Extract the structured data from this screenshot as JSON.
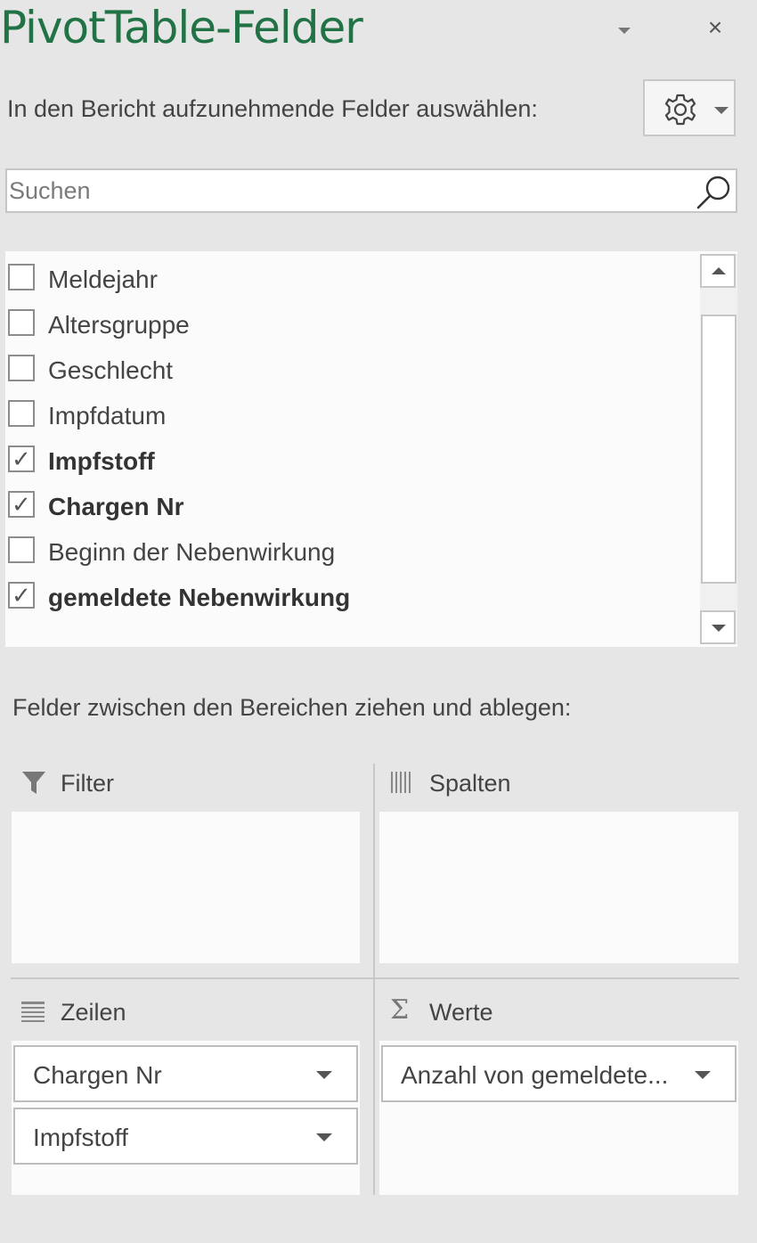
{
  "header": {
    "title": "PivotTable-Felder",
    "close_glyph": "×"
  },
  "chooser": {
    "label": "In den Bericht aufzunehmende Felder auswählen:",
    "settings_icon": "gear-icon"
  },
  "search": {
    "placeholder": "Suchen",
    "value": ""
  },
  "fields": [
    {
      "label": "Meldejahr",
      "checked": false
    },
    {
      "label": "Altersgruppe",
      "checked": false
    },
    {
      "label": "Geschlecht",
      "checked": false
    },
    {
      "label": "Impfdatum",
      "checked": false
    },
    {
      "label": "Impfstoff",
      "checked": true
    },
    {
      "label": "Chargen Nr",
      "checked": true
    },
    {
      "label": "Beginn der Nebenwirkung",
      "checked": false
    },
    {
      "label": "gemeldete Nebenwirkung",
      "checked": true
    }
  ],
  "areas": {
    "instruction": "Felder zwischen den Bereichen ziehen und ablegen:",
    "filter": {
      "label": "Filter",
      "items": []
    },
    "columns": {
      "label": "Spalten",
      "items": []
    },
    "rows": {
      "label": "Zeilen",
      "items": [
        "Chargen Nr",
        "Impfstoff"
      ]
    },
    "values": {
      "label": "Werte",
      "sigma": "Σ",
      "items": [
        "Anzahl von gemeldete..."
      ]
    }
  },
  "colors": {
    "title_green": "#217346",
    "panel_bg": "#e6e6e6"
  }
}
